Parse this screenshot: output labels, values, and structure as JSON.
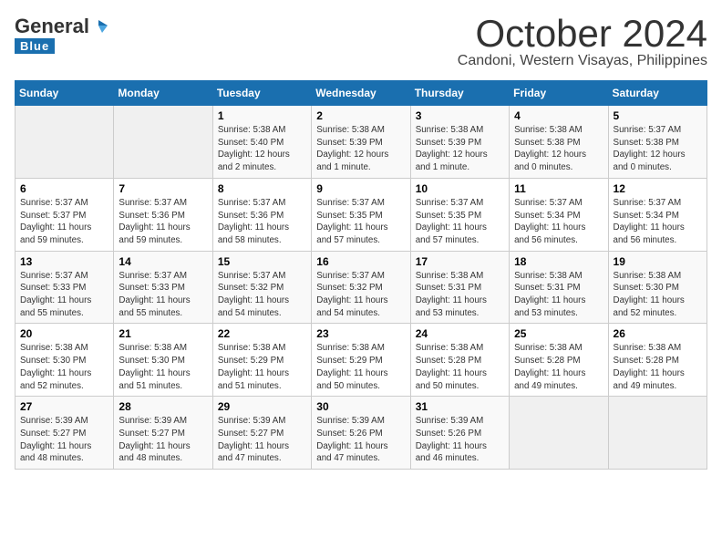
{
  "header": {
    "logo_general": "General",
    "logo_blue": "Blue",
    "month": "October 2024",
    "location": "Candoni, Western Visayas, Philippines"
  },
  "days_of_week": [
    "Sunday",
    "Monday",
    "Tuesday",
    "Wednesday",
    "Thursday",
    "Friday",
    "Saturday"
  ],
  "weeks": [
    [
      {
        "day": "",
        "info": ""
      },
      {
        "day": "",
        "info": ""
      },
      {
        "day": "1",
        "info": "Sunrise: 5:38 AM\nSunset: 5:40 PM\nDaylight: 12 hours\nand 2 minutes."
      },
      {
        "day": "2",
        "info": "Sunrise: 5:38 AM\nSunset: 5:39 PM\nDaylight: 12 hours\nand 1 minute."
      },
      {
        "day": "3",
        "info": "Sunrise: 5:38 AM\nSunset: 5:39 PM\nDaylight: 12 hours\nand 1 minute."
      },
      {
        "day": "4",
        "info": "Sunrise: 5:38 AM\nSunset: 5:38 PM\nDaylight: 12 hours\nand 0 minutes."
      },
      {
        "day": "5",
        "info": "Sunrise: 5:37 AM\nSunset: 5:38 PM\nDaylight: 12 hours\nand 0 minutes."
      }
    ],
    [
      {
        "day": "6",
        "info": "Sunrise: 5:37 AM\nSunset: 5:37 PM\nDaylight: 11 hours\nand 59 minutes."
      },
      {
        "day": "7",
        "info": "Sunrise: 5:37 AM\nSunset: 5:36 PM\nDaylight: 11 hours\nand 59 minutes."
      },
      {
        "day": "8",
        "info": "Sunrise: 5:37 AM\nSunset: 5:36 PM\nDaylight: 11 hours\nand 58 minutes."
      },
      {
        "day": "9",
        "info": "Sunrise: 5:37 AM\nSunset: 5:35 PM\nDaylight: 11 hours\nand 57 minutes."
      },
      {
        "day": "10",
        "info": "Sunrise: 5:37 AM\nSunset: 5:35 PM\nDaylight: 11 hours\nand 57 minutes."
      },
      {
        "day": "11",
        "info": "Sunrise: 5:37 AM\nSunset: 5:34 PM\nDaylight: 11 hours\nand 56 minutes."
      },
      {
        "day": "12",
        "info": "Sunrise: 5:37 AM\nSunset: 5:34 PM\nDaylight: 11 hours\nand 56 minutes."
      }
    ],
    [
      {
        "day": "13",
        "info": "Sunrise: 5:37 AM\nSunset: 5:33 PM\nDaylight: 11 hours\nand 55 minutes."
      },
      {
        "day": "14",
        "info": "Sunrise: 5:37 AM\nSunset: 5:33 PM\nDaylight: 11 hours\nand 55 minutes."
      },
      {
        "day": "15",
        "info": "Sunrise: 5:37 AM\nSunset: 5:32 PM\nDaylight: 11 hours\nand 54 minutes."
      },
      {
        "day": "16",
        "info": "Sunrise: 5:37 AM\nSunset: 5:32 PM\nDaylight: 11 hours\nand 54 minutes."
      },
      {
        "day": "17",
        "info": "Sunrise: 5:38 AM\nSunset: 5:31 PM\nDaylight: 11 hours\nand 53 minutes."
      },
      {
        "day": "18",
        "info": "Sunrise: 5:38 AM\nSunset: 5:31 PM\nDaylight: 11 hours\nand 53 minutes."
      },
      {
        "day": "19",
        "info": "Sunrise: 5:38 AM\nSunset: 5:30 PM\nDaylight: 11 hours\nand 52 minutes."
      }
    ],
    [
      {
        "day": "20",
        "info": "Sunrise: 5:38 AM\nSunset: 5:30 PM\nDaylight: 11 hours\nand 52 minutes."
      },
      {
        "day": "21",
        "info": "Sunrise: 5:38 AM\nSunset: 5:30 PM\nDaylight: 11 hours\nand 51 minutes."
      },
      {
        "day": "22",
        "info": "Sunrise: 5:38 AM\nSunset: 5:29 PM\nDaylight: 11 hours\nand 51 minutes."
      },
      {
        "day": "23",
        "info": "Sunrise: 5:38 AM\nSunset: 5:29 PM\nDaylight: 11 hours\nand 50 minutes."
      },
      {
        "day": "24",
        "info": "Sunrise: 5:38 AM\nSunset: 5:28 PM\nDaylight: 11 hours\nand 50 minutes."
      },
      {
        "day": "25",
        "info": "Sunrise: 5:38 AM\nSunset: 5:28 PM\nDaylight: 11 hours\nand 49 minutes."
      },
      {
        "day": "26",
        "info": "Sunrise: 5:38 AM\nSunset: 5:28 PM\nDaylight: 11 hours\nand 49 minutes."
      }
    ],
    [
      {
        "day": "27",
        "info": "Sunrise: 5:39 AM\nSunset: 5:27 PM\nDaylight: 11 hours\nand 48 minutes."
      },
      {
        "day": "28",
        "info": "Sunrise: 5:39 AM\nSunset: 5:27 PM\nDaylight: 11 hours\nand 48 minutes."
      },
      {
        "day": "29",
        "info": "Sunrise: 5:39 AM\nSunset: 5:27 PM\nDaylight: 11 hours\nand 47 minutes."
      },
      {
        "day": "30",
        "info": "Sunrise: 5:39 AM\nSunset: 5:26 PM\nDaylight: 11 hours\nand 47 minutes."
      },
      {
        "day": "31",
        "info": "Sunrise: 5:39 AM\nSunset: 5:26 PM\nDaylight: 11 hours\nand 46 minutes."
      },
      {
        "day": "",
        "info": ""
      },
      {
        "day": "",
        "info": ""
      }
    ]
  ]
}
